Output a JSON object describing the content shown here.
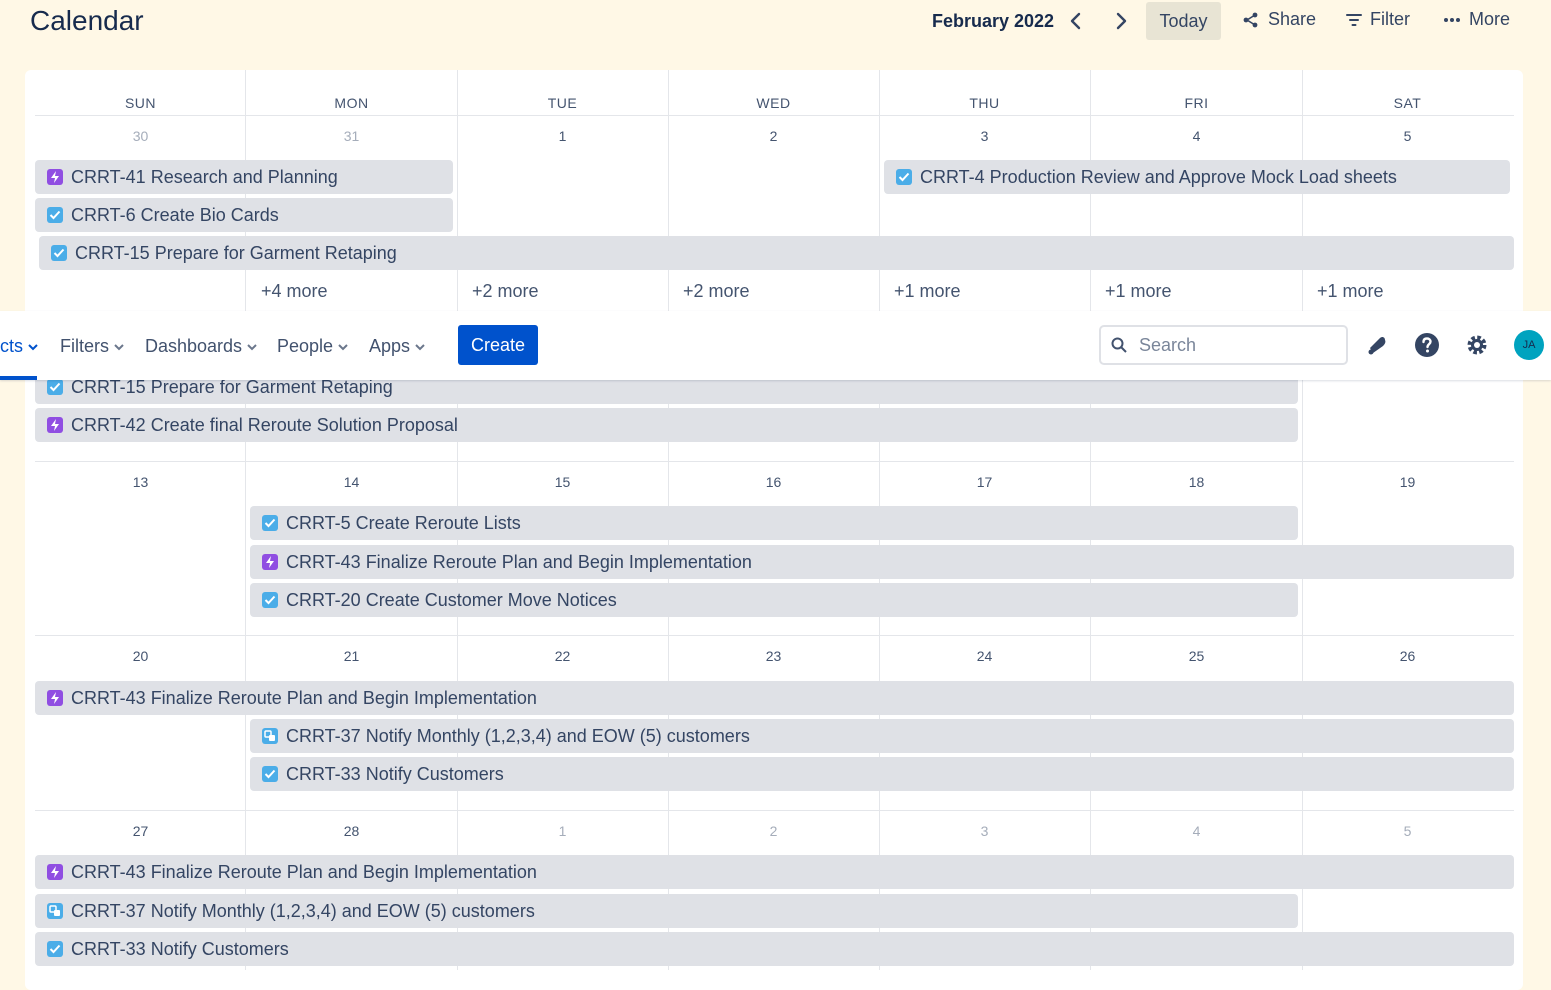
{
  "header": {
    "title": "Calendar",
    "month": "February 2022",
    "today_label": "Today",
    "share_label": "Share",
    "filter_label": "Filter",
    "more_label": "More"
  },
  "weekdays": [
    "SUN",
    "MON",
    "TUE",
    "WED",
    "THU",
    "FRI",
    "SAT"
  ],
  "weeks": [
    {
      "days": [
        {
          "num": "30",
          "muted": true
        },
        {
          "num": "31",
          "muted": true
        },
        {
          "num": "1"
        },
        {
          "num": "2"
        },
        {
          "num": "3"
        },
        {
          "num": "4"
        },
        {
          "num": "5"
        }
      ],
      "events": [
        {
          "icon": "epic",
          "label": "CRRT-41 Research and Planning"
        },
        {
          "icon": "task",
          "label": "CRRT-4 Production Review and Approve Mock Load sheets"
        },
        {
          "icon": "task",
          "label": "CRRT-6 Create Bio Cards"
        },
        {
          "icon": "task",
          "label": "CRRT-15 Prepare for Garment Retaping"
        }
      ],
      "more": [
        "+4 more",
        "+2 more",
        "+2 more",
        "+1 more",
        "+1 more",
        "+1 more"
      ]
    },
    {
      "days": [],
      "events": [
        {
          "icon": "task",
          "label": "CRRT-15 Prepare for Garment Retaping"
        },
        {
          "icon": "epic",
          "label": "CRRT-42 Create final Reroute Solution Proposal"
        }
      ]
    },
    {
      "days": [
        {
          "num": "13"
        },
        {
          "num": "14"
        },
        {
          "num": "15"
        },
        {
          "num": "16"
        },
        {
          "num": "17"
        },
        {
          "num": "18"
        },
        {
          "num": "19"
        }
      ],
      "events": [
        {
          "icon": "task",
          "label": "CRRT-5 Create Reroute Lists"
        },
        {
          "icon": "epic",
          "label": "CRRT-43 Finalize Reroute Plan and Begin Implementation"
        },
        {
          "icon": "task",
          "label": "CRRT-20 Create Customer Move Notices"
        }
      ]
    },
    {
      "days": [
        {
          "num": "20"
        },
        {
          "num": "21"
        },
        {
          "num": "22"
        },
        {
          "num": "23"
        },
        {
          "num": "24"
        },
        {
          "num": "25"
        },
        {
          "num": "26"
        }
      ],
      "events": [
        {
          "icon": "epic",
          "label": "CRRT-43 Finalize Reroute Plan and Begin Implementation"
        },
        {
          "icon": "subtask",
          "label": "CRRT-37 Notify Monthly (1,2,3,4) and EOW (5) customers"
        },
        {
          "icon": "task",
          "label": "CRRT-33 Notify Customers"
        }
      ]
    },
    {
      "days": [
        {
          "num": "27"
        },
        {
          "num": "28"
        },
        {
          "num": "1",
          "muted": true
        },
        {
          "num": "2",
          "muted": true
        },
        {
          "num": "3",
          "muted": true
        },
        {
          "num": "4",
          "muted": true
        },
        {
          "num": "5",
          "muted": true
        }
      ],
      "events": [
        {
          "icon": "epic",
          "label": "CRRT-43 Finalize Reroute Plan and Begin Implementation"
        },
        {
          "icon": "subtask",
          "label": "CRRT-37 Notify Monthly (1,2,3,4) and EOW (5) customers"
        },
        {
          "icon": "task",
          "label": "CRRT-33 Notify Customers"
        }
      ]
    }
  ],
  "topnav": {
    "partial_label": "cts",
    "items": [
      "Filters",
      "Dashboards",
      "People",
      "Apps"
    ],
    "create_label": "Create",
    "search_placeholder": "Search",
    "avatar_initials": "JA"
  },
  "colors": {
    "page_bg": "#fff8e6",
    "event_bg": "#dfe1e6",
    "epic": "#904ee2",
    "task": "#4bade8",
    "primary": "#0052cc",
    "avatar": "#00a3bf"
  }
}
